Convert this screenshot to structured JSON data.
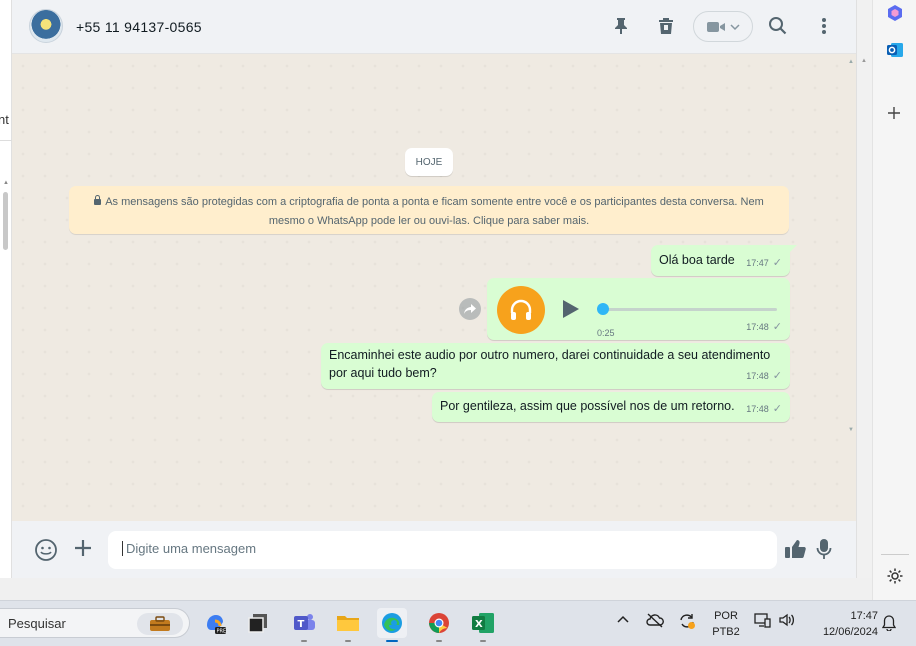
{
  "left_panel": {
    "fragment": "nt"
  },
  "header": {
    "contact_name": "+55 11 94137-0565"
  },
  "chat": {
    "day_label": "HOJE",
    "encryption_notice": "As mensagens são protegidas com a criptografia de ponta a ponta e ficam somente entre você e os participantes desta conversa. Nem mesmo o WhatsApp pode ler ou ouvi-las. Clique para saber mais.",
    "messages": [
      {
        "text": "Olá boa tarde",
        "time": "17:47"
      },
      {
        "duration": "0:25",
        "time": "17:48"
      },
      {
        "text": "Encaminhei este audio por outro numero, darei continuidade a seu atendimento por aqui tudo bem?",
        "time": "17:48"
      },
      {
        "text": "Por gentileza, assim que possível nos de um retorno.",
        "time": "17:48"
      }
    ]
  },
  "composer": {
    "placeholder": "Digite uma mensagem"
  },
  "taskbar": {
    "search_label": "Pesquisar",
    "language_line1": "POR",
    "language_line2": "PTB2",
    "time": "17:47",
    "date": "12/06/2024"
  },
  "colors": {
    "bubble_outgoing": "#d9fdd3",
    "notice_bg": "#ffeecd",
    "audio_avatar": "#f7a21c",
    "audio_progress": "#30b6f6",
    "accent_green": "#11a683"
  }
}
